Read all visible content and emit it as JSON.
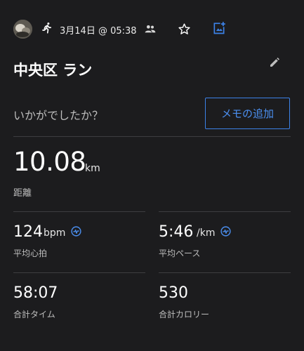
{
  "header": {
    "datetime": "3月14日 @ 05:38",
    "icons": [
      "avatar",
      "running-icon",
      "people-icon",
      "star-icon",
      "add-photo-icon"
    ]
  },
  "activity": {
    "title": "中央区 ラン",
    "prompt": "いかがでしたか？",
    "memo_button": "メモの追加"
  },
  "distance": {
    "value": "10.08",
    "unit": "km",
    "label": "距離"
  },
  "stats": {
    "heart_rate": {
      "value": "124",
      "unit": "bpm",
      "label": "平均心拍"
    },
    "pace": {
      "value": "5:46",
      "unit": "/km",
      "label": "平均ペース"
    },
    "time": {
      "value": "58:07",
      "label": "合計タイム"
    },
    "calories": {
      "value": "530",
      "label": "合計カロリー"
    }
  },
  "colors": {
    "background": "#1c1c1e",
    "accent": "#3c82e8",
    "text": "#ffffff",
    "muted": "#bdbdbd"
  }
}
